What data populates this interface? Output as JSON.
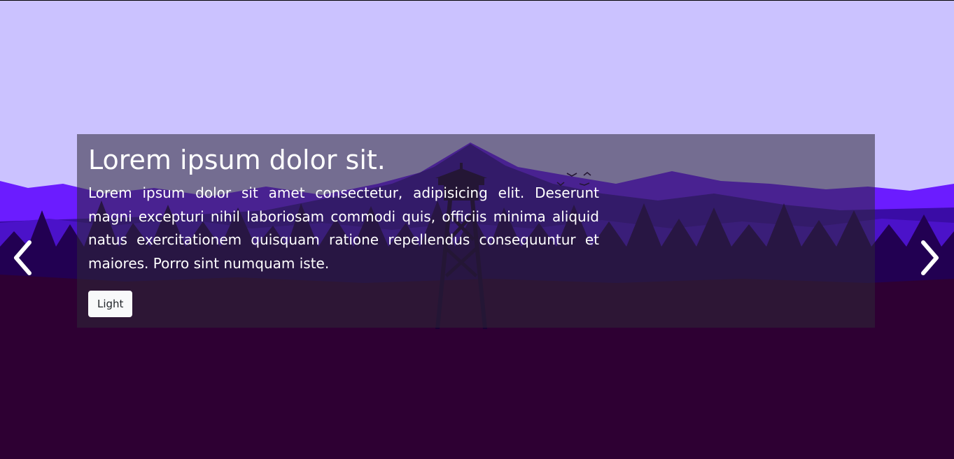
{
  "slide": {
    "title": "Lorem ipsum dolor sit.",
    "text": "Lorem ipsum dolor sit amet consectetur, adipisicing elit. Deserunt magni excepturi nihil laboriosam commodi quis, officiis minima aliquid natus exercitationem quisquam ratione repellendus consequuntur et maiores. Porro sint numquam iste.",
    "button_label": "Light"
  },
  "controls": {
    "prev_icon": "chevron-left-icon",
    "next_icon": "chevron-right-icon"
  },
  "colors": {
    "sky": "#cbc2ff",
    "far_mountains": "#6b1cff",
    "peak": "#3a0ca6",
    "forest": "#220052",
    "ground": "#2e0033",
    "caption_overlay": "rgba(45,40,55,0.55)",
    "button_bg": "#f8f9fa"
  }
}
